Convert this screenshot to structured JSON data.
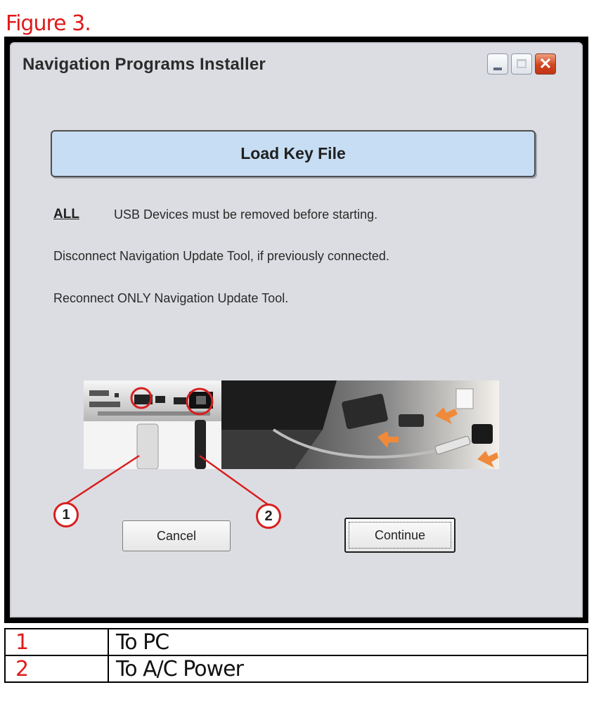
{
  "figure": {
    "title": "Figure 3."
  },
  "window": {
    "title": "Navigation Programs Installer",
    "controls": {
      "minimize_icon": "minimize-icon",
      "maximize_icon": "maximize-icon",
      "close_icon": "close-icon"
    }
  },
  "dialog": {
    "header": "Load Key File",
    "all_word": "ALL",
    "line1": "USB Devices must be removed before starting.",
    "line2": "Disconnect Navigation Update Tool, if previously connected.",
    "line3": "Reconnect ONLY Navigation Update Tool.",
    "callout_1": "1",
    "callout_2": "2",
    "cancel_label": "Cancel",
    "continue_label": "Continue"
  },
  "legend": [
    {
      "number": "1",
      "text": "To PC"
    },
    {
      "number": "2",
      "text": "To A/C Power"
    }
  ],
  "colors": {
    "accent_red": "#e01b1b",
    "header_fill": "#c7ddf3",
    "window_bg": "#dcdde2"
  }
}
